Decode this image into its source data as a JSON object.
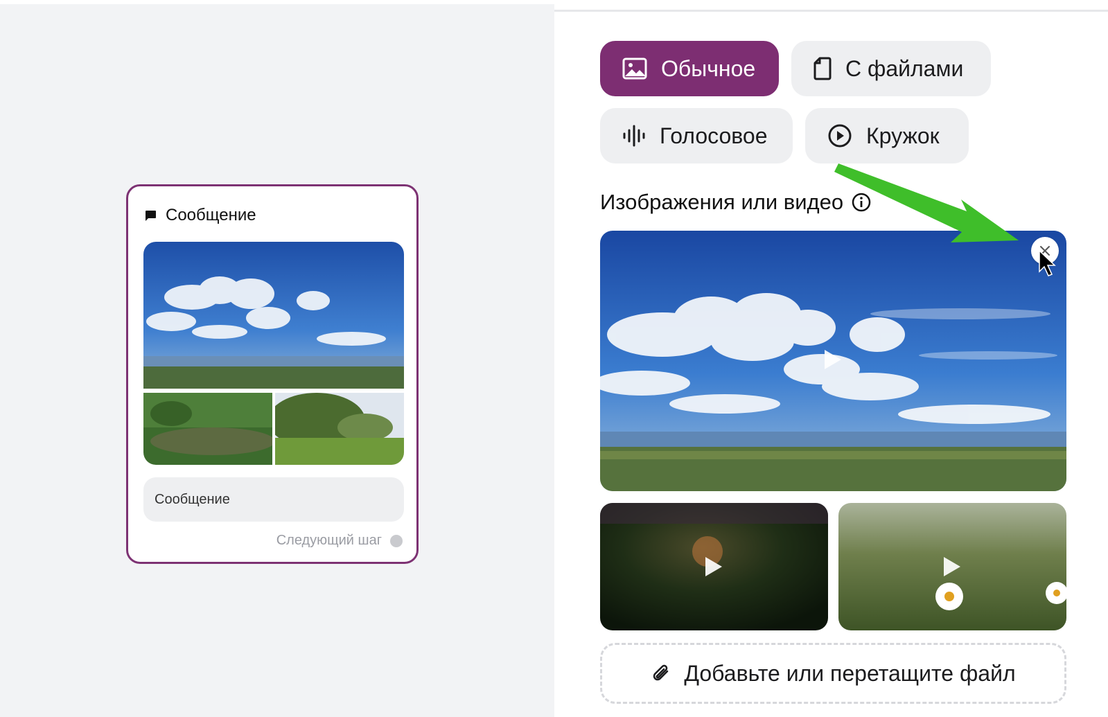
{
  "node": {
    "icon": "chat-bubble-icon",
    "title": "Сообщение",
    "text_placeholder": "Сообщение",
    "next_step_label": "Следующий шаг"
  },
  "message_types": [
    {
      "label": "Обычное",
      "icon": "image-icon",
      "active": true
    },
    {
      "label": "С файлами",
      "icon": "file-icon",
      "active": false
    },
    {
      "label": "Голосовое",
      "icon": "waveform-icon",
      "active": false
    },
    {
      "label": "Кружок",
      "icon": "play-circle-icon",
      "active": false
    }
  ],
  "media_section": {
    "title": "Изображения или видео",
    "info_icon": "info-icon",
    "items": [
      "sky-video",
      "dark-grass-video",
      "daisy-video"
    ]
  },
  "upload": {
    "icon": "paperclip-icon",
    "label": "Добавьте или перетащите файл"
  },
  "colors": {
    "accent": "#7d2e72",
    "annotation_arrow": "#3fbe2a"
  }
}
